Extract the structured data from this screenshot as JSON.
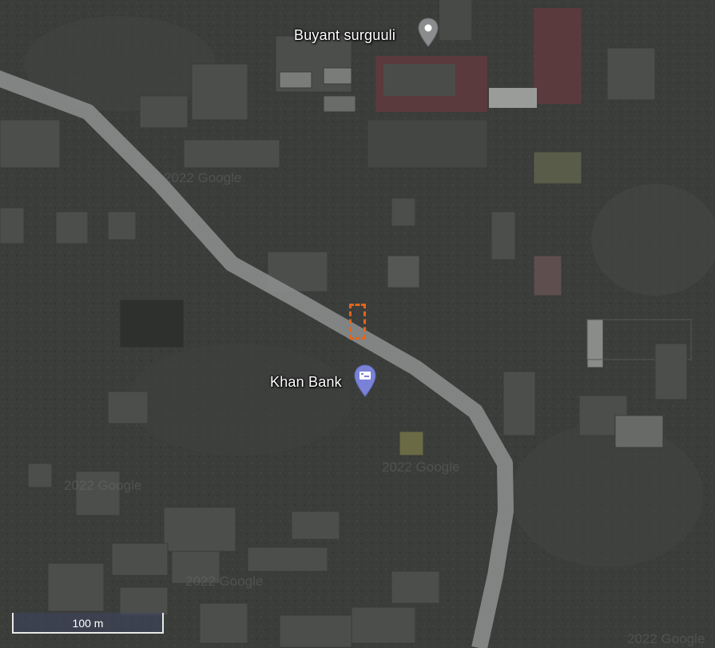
{
  "map": {
    "type": "satellite",
    "road_color": "#8f9190",
    "selection_color": "#e0661c"
  },
  "pois": [
    {
      "label": "Buyant surguuli",
      "icon": "school-pin-icon"
    },
    {
      "label": "Khan Bank",
      "icon": "bank-pin-icon"
    }
  ],
  "watermarks": [
    "2022 Google",
    "2022 Google",
    "2022 Google",
    "2022 Google",
    "2022 Google"
  ],
  "scale": {
    "label": "100 m"
  }
}
